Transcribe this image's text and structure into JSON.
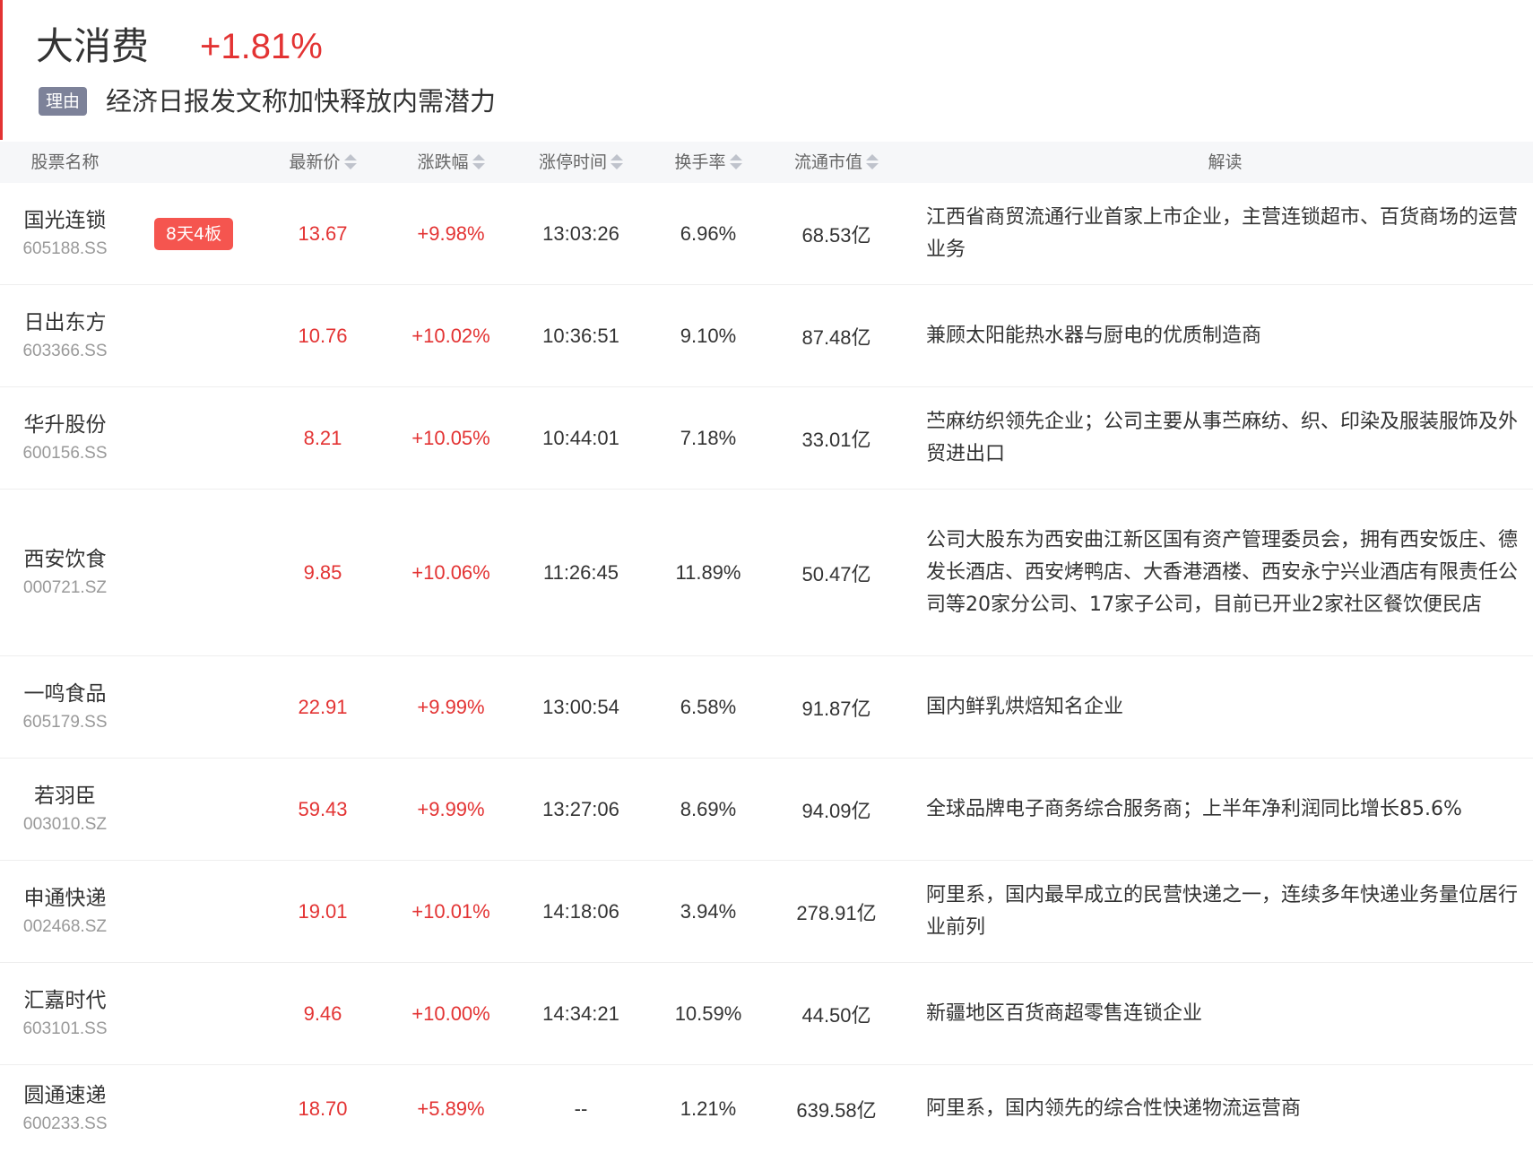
{
  "header": {
    "title": "大消费",
    "change": "+1.81%",
    "reason_badge": "理由",
    "reason_text": "经济日报发文称加快释放内需潜力"
  },
  "columns": {
    "name": "股票名称",
    "price": "最新价",
    "change": "涨跌幅",
    "limit_time": "涨停时间",
    "turnover": "换手率",
    "market_cap": "流通市值",
    "comment": "解读"
  },
  "colors": {
    "accent_red": "#e33333",
    "tag_red": "#f5554f",
    "badge_gray": "#7d8299",
    "header_bg": "#f6f7f9"
  },
  "icons": {
    "sort": "sort-icon"
  },
  "rows": [
    {
      "name": "国光连锁",
      "code": "605188.SS",
      "tag": "8天4板",
      "price": "13.67",
      "change": "+9.98%",
      "time": "13:03:26",
      "turnover": "6.96%",
      "cap": "68.53亿",
      "desc": "江西省商贸流通行业首家上市企业，主营连锁超市、百货商场的运营业务"
    },
    {
      "name": "日出东方",
      "code": "603366.SS",
      "tag": "",
      "price": "10.76",
      "change": "+10.02%",
      "time": "10:36:51",
      "turnover": "9.10%",
      "cap": "87.48亿",
      "desc": "兼顾太阳能热水器与厨电的优质制造商"
    },
    {
      "name": "华升股份",
      "code": "600156.SS",
      "tag": "",
      "price": "8.21",
      "change": "+10.05%",
      "time": "10:44:01",
      "turnover": "7.18%",
      "cap": "33.01亿",
      "desc": "苎麻纺织领先企业；公司主要从事苎麻纺、织、印染及服装服饰及外贸进出口"
    },
    {
      "name": "西安饮食",
      "code": "000721.SZ",
      "tag": "",
      "price": "9.85",
      "change": "+10.06%",
      "time": "11:26:45",
      "turnover": "11.89%",
      "cap": "50.47亿",
      "desc": "公司大股东为西安曲江新区国有资产管理委员会，拥有西安饭庄、德发长酒店、西安烤鸭店、大香港酒楼、西安永宁兴业酒店有限责任公司等20家分公司、17家子公司，目前已开业2家社区餐饮便民店"
    },
    {
      "name": "一鸣食品",
      "code": "605179.SS",
      "tag": "",
      "price": "22.91",
      "change": "+9.99%",
      "time": "13:00:54",
      "turnover": "6.58%",
      "cap": "91.87亿",
      "desc": "国内鲜乳烘焙知名企业"
    },
    {
      "name": "若羽臣",
      "code": "003010.SZ",
      "tag": "",
      "price": "59.43",
      "change": "+9.99%",
      "time": "13:27:06",
      "turnover": "8.69%",
      "cap": "94.09亿",
      "desc": "全球品牌电子商务综合服务商；上半年净利润同比增长85.6%"
    },
    {
      "name": "申通快递",
      "code": "002468.SZ",
      "tag": "",
      "price": "19.01",
      "change": "+10.01%",
      "time": "14:18:06",
      "turnover": "3.94%",
      "cap": "278.91亿",
      "desc": "阿里系，国内最早成立的民营快递之一，连续多年快递业务量位居行业前列"
    },
    {
      "name": "汇嘉时代",
      "code": "603101.SS",
      "tag": "",
      "price": "9.46",
      "change": "+10.00%",
      "time": "14:34:21",
      "turnover": "10.59%",
      "cap": "44.50亿",
      "desc": "新疆地区百货商超零售连锁企业"
    },
    {
      "name": "圆通速递",
      "code": "600233.SS",
      "tag": "",
      "price": "18.70",
      "change": "+5.89%",
      "time": "--",
      "turnover": "1.21%",
      "cap": "639.58亿",
      "desc": "阿里系，国内领先的综合性快递物流运营商"
    }
  ]
}
